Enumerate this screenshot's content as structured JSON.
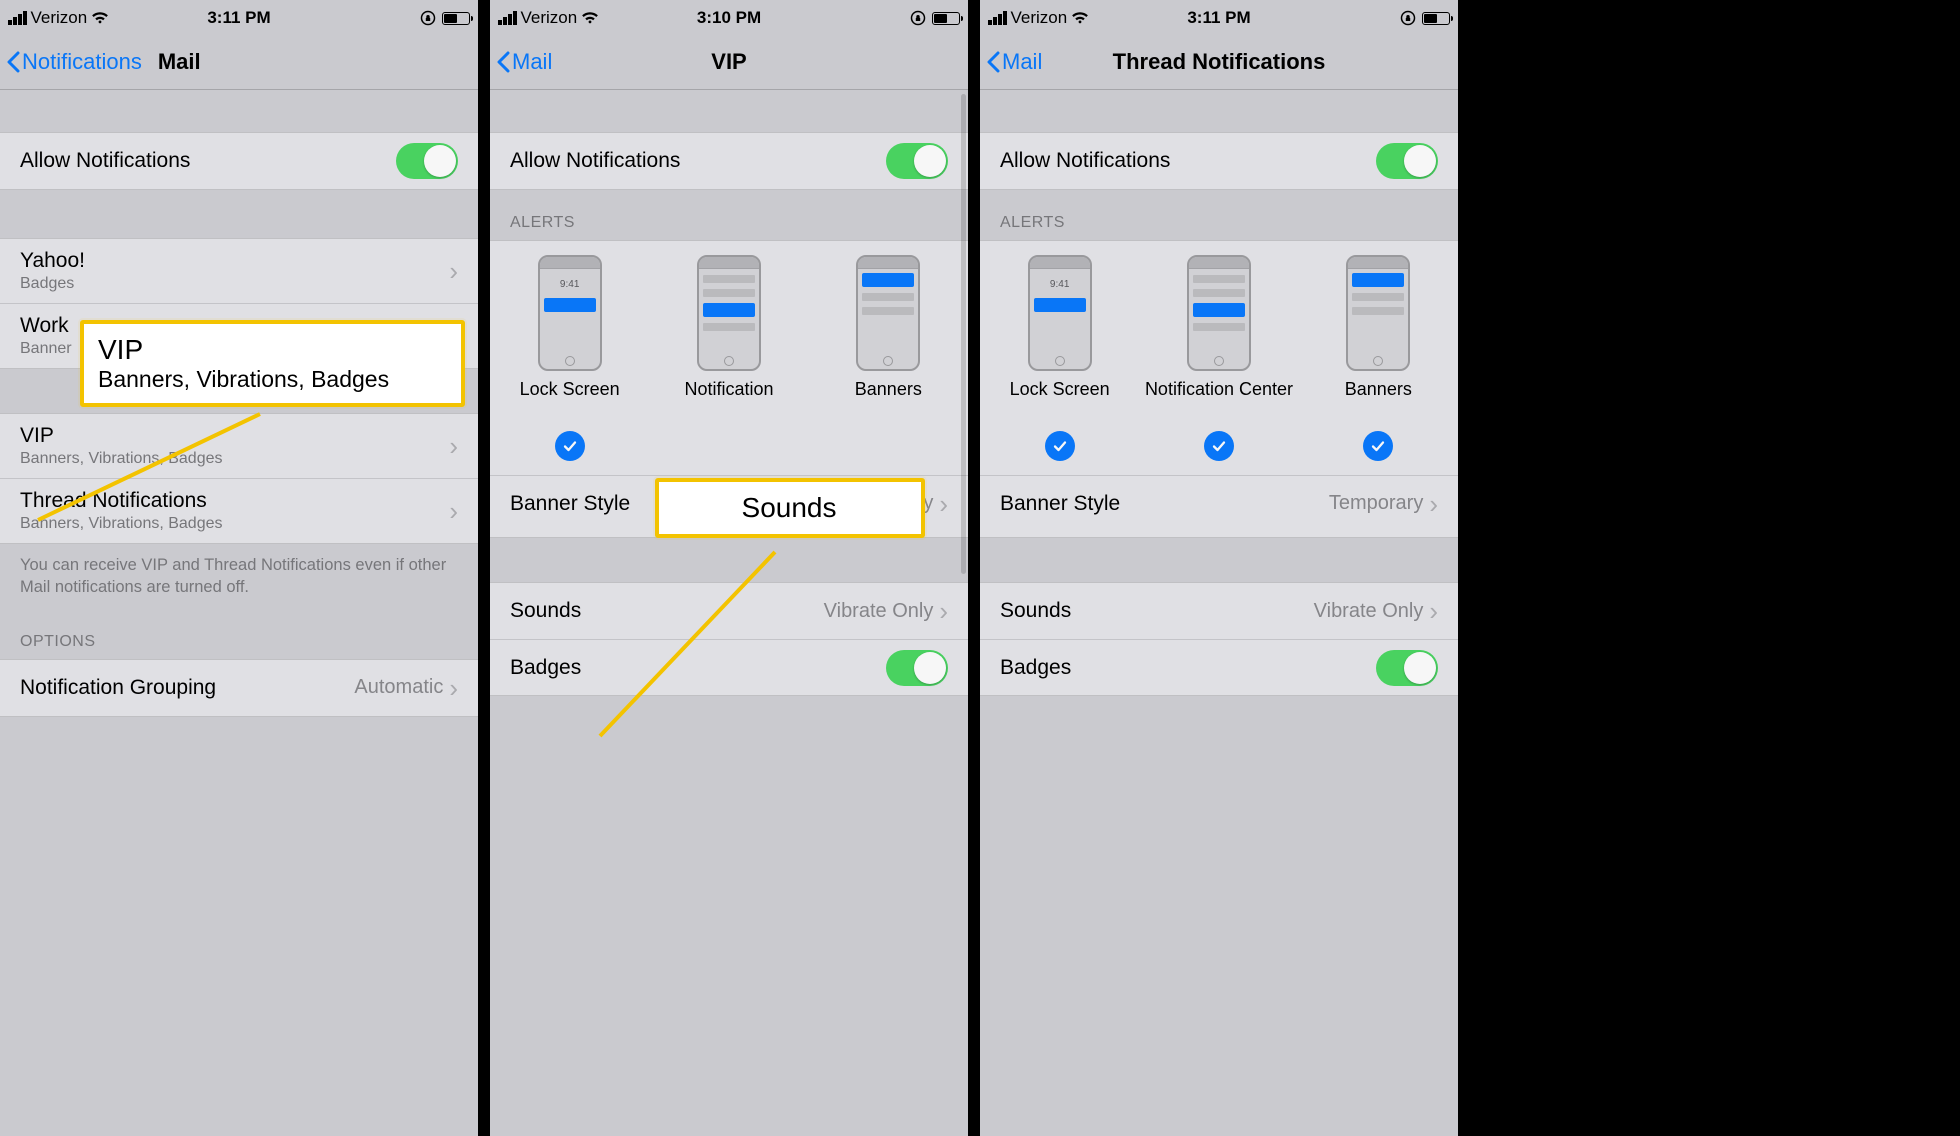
{
  "screens": [
    {
      "status": {
        "carrier": "Verizon",
        "time": "3:11 PM"
      },
      "nav": {
        "back": "Notifications",
        "title": "Mail"
      },
      "allow_label": "Allow Notifications",
      "accounts": [
        {
          "title": "Yahoo!",
          "sub": "Badges"
        },
        {
          "title": "Work",
          "sub": "Banner"
        }
      ],
      "vip_group": [
        {
          "title": "VIP",
          "sub": "Banners, Vibrations, Badges"
        },
        {
          "title": "Thread Notifications",
          "sub": "Banners, Vibrations, Badges"
        }
      ],
      "vip_footer": "You can receive VIP and Thread Notifications even if other Mail notifications are turned off.",
      "options_header": "OPTIONS",
      "grouping": {
        "label": "Notification Grouping",
        "value": "Automatic"
      },
      "callout": {
        "t1": "VIP",
        "t2": "Banners, Vibrations, Badges"
      }
    },
    {
      "status": {
        "carrier": "Verizon",
        "time": "3:10 PM"
      },
      "nav": {
        "back": "Mail",
        "title": "VIP"
      },
      "allow_label": "Allow Notifications",
      "alerts_header": "ALERTS",
      "alert_opts": [
        "Lock Screen",
        "Notification",
        "Banners"
      ],
      "mini_time": "9:41",
      "banner_style": {
        "label": "Banner Style",
        "value": "Temporary"
      },
      "sounds": {
        "label": "Sounds",
        "value": "Vibrate Only"
      },
      "badges_label": "Badges",
      "callout": {
        "t1": "Sounds"
      }
    },
    {
      "status": {
        "carrier": "Verizon",
        "time": "3:11 PM"
      },
      "nav": {
        "back": "Mail",
        "title": "Thread Notifications"
      },
      "allow_label": "Allow Notifications",
      "alerts_header": "ALERTS",
      "alert_opts": [
        "Lock Screen",
        "Notification Center",
        "Banners"
      ],
      "mini_time": "9:41",
      "banner_style": {
        "label": "Banner Style",
        "value": "Temporary"
      },
      "sounds": {
        "label": "Sounds",
        "value": "Vibrate Only"
      },
      "badges_label": "Badges"
    }
  ]
}
